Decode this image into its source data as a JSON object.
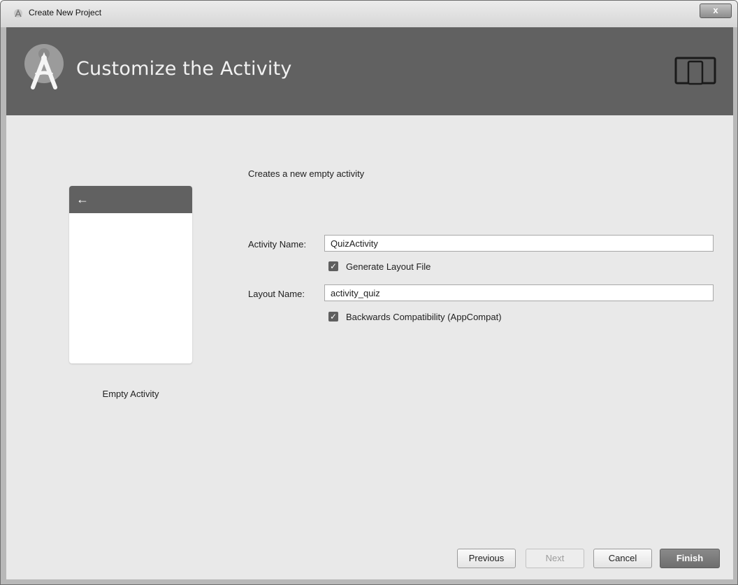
{
  "window": {
    "title": "Create New Project",
    "close_label": "x"
  },
  "header": {
    "title": "Customize the Activity",
    "logo_icon": "android-studio-logo-icon",
    "device_icon": "phone-tablet-icon"
  },
  "preview": {
    "back_glyph": "←",
    "template_label": "Empty Activity"
  },
  "form": {
    "description": "Creates a new empty activity",
    "activity_name_label": "Activity Name:",
    "activity_name_value": "QuizActivity",
    "generate_layout_label": "Generate Layout File",
    "generate_layout_checked": true,
    "layout_name_label": "Layout Name:",
    "layout_name_value": "activity_quiz",
    "backwards_compat_label": "Backwards Compatibility (AppCompat)",
    "backwards_compat_checked": true,
    "check_glyph": "✓"
  },
  "buttons": {
    "previous": "Previous",
    "next": "Next",
    "cancel": "Cancel",
    "finish": "Finish"
  },
  "colors": {
    "header_bg": "#616161",
    "content_bg": "#e9e9e9",
    "primary_button": "#777777"
  }
}
